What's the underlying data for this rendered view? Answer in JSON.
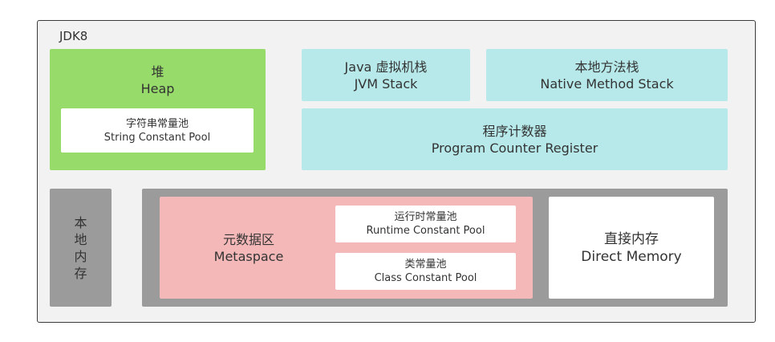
{
  "jdk": {
    "title": "JDK8"
  },
  "heap": {
    "name_cn": "堆",
    "name_en": "Heap",
    "string_pool": {
      "name_cn": "字符串常量池",
      "name_en": "String Constant Pool"
    }
  },
  "jvm_stack": {
    "name_cn": "Java 虚拟机栈",
    "name_en": "JVM Stack"
  },
  "native_stack": {
    "name_cn": "本地方法栈",
    "name_en": "Native Method Stack"
  },
  "pc_register": {
    "name_cn": "程序计数器",
    "name_en": "Program Counter Register"
  },
  "native_memory": {
    "chars": [
      "本",
      "地",
      "内",
      "存"
    ]
  },
  "metaspace": {
    "name_cn": "元数据区",
    "name_en": "Metaspace",
    "runtime_pool": {
      "name_cn": "运行时常量池",
      "name_en": "Runtime Constant Pool"
    },
    "class_pool": {
      "name_cn": "类常量池",
      "name_en": "Class Constant Pool"
    }
  },
  "direct_memory": {
    "name_cn": "直接内存",
    "name_en": "Direct Memory"
  },
  "colors": {
    "heap": "#97db6a",
    "stack": "#b7e9ea",
    "native": "#9b9b9b",
    "metaspace": "#f4b8b8",
    "box": "#ffffff",
    "container": "#f2f2f2"
  }
}
